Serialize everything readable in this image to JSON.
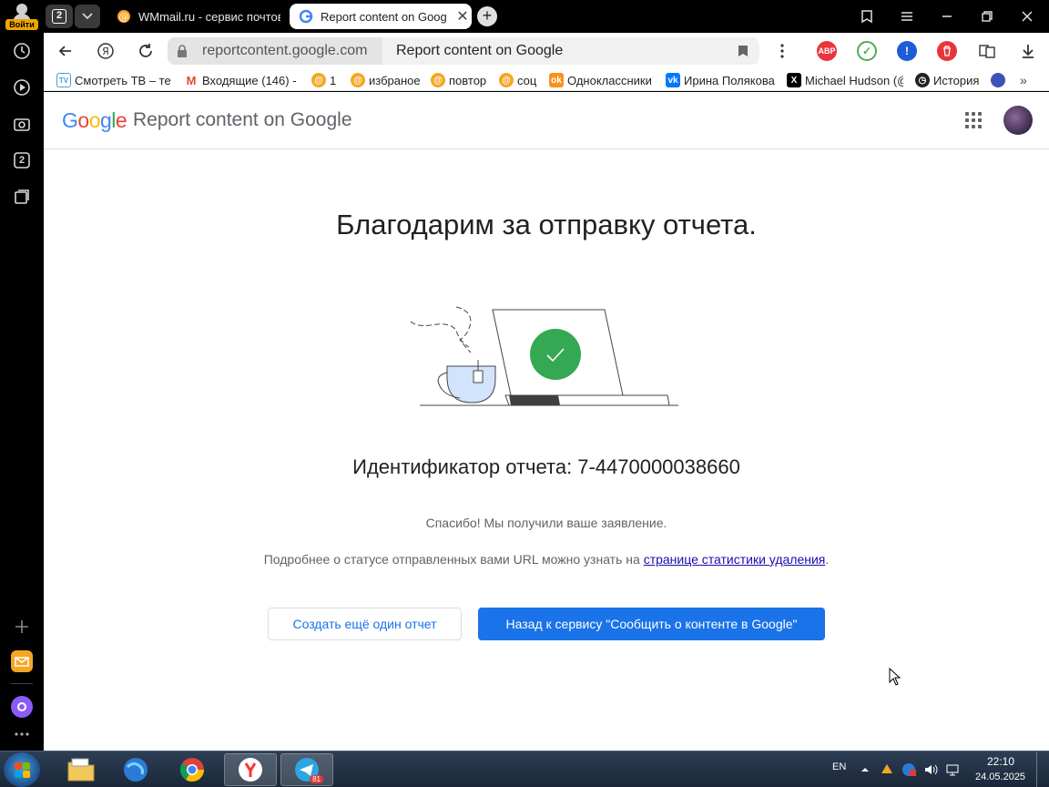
{
  "sidebar": {
    "login_label": "Войти",
    "icons": [
      "history-icon",
      "play-icon",
      "camera-icon",
      "tabs-count-icon",
      "notes-icon",
      "add-icon",
      "mail-icon",
      "alice-icon",
      "more-icon"
    ],
    "tabs_count": "2"
  },
  "tabs": {
    "count": "2",
    "items": [
      {
        "title": "WMmail.ru - сервис почтовых",
        "active": false
      },
      {
        "title": "Report content on Goog",
        "active": true
      }
    ]
  },
  "address_bar": {
    "host": "reportcontent.google.com",
    "page_title": "Report content on Google"
  },
  "extensions": [
    {
      "name": "adblock-plus",
      "label": "ABP",
      "color": "#e8353b"
    },
    {
      "name": "adguard",
      "label": "✓",
      "color": "#4caf50"
    },
    {
      "name": "security-ext",
      "label": "!",
      "color": "#1e5cd8"
    },
    {
      "name": "trash-ext",
      "label": "",
      "color": "#e8353b"
    },
    {
      "name": "translate-ext",
      "label": "",
      "color": "#333333"
    }
  ],
  "bookmarks": [
    {
      "label": "Смотреть ТВ – те",
      "icon": "tv-icon"
    },
    {
      "label": "Входящие (146) -",
      "icon": "gmail-icon"
    },
    {
      "label": "1",
      "icon": "wmmail-icon"
    },
    {
      "label": "избраное",
      "icon": "wmmail-icon"
    },
    {
      "label": "повтор",
      "icon": "wmmail-icon"
    },
    {
      "label": "соц",
      "icon": "wmmail-icon"
    },
    {
      "label": "Одноклассники",
      "icon": "ok-icon"
    },
    {
      "label": "Ирина Полякова",
      "icon": "vk-icon"
    },
    {
      "label": "Michael Hudson (@",
      "icon": "x-icon"
    },
    {
      "label": "История",
      "icon": "history-icon"
    }
  ],
  "header": {
    "logo": "Google",
    "product": "Report content on Google"
  },
  "main": {
    "title": "Благодарим за отправку отчета.",
    "report_id_label": "Идентификатор отчета:",
    "report_id_value": "7-4470000038660",
    "thanks_text": "Спасибо! Мы получили ваше заявление.",
    "more_info_prefix": "Подробнее о статусе отправленных вами URL можно узнать на ",
    "more_info_link": "странице статистики удаления",
    "more_info_suffix": ".",
    "btn_new_report": "Создать ещё один отчет",
    "btn_back": "Назад к сервису \"Сообщить о контенте в Google\""
  },
  "taskbar": {
    "language": "EN",
    "time": "22:10",
    "date": "24.05.2025",
    "telegram_badge": "81"
  },
  "colors": {
    "google_blue": "#4285f4",
    "google_red": "#ea4335",
    "google_yellow": "#fbbc05",
    "google_green": "#34a853",
    "primary_button": "#1a73e8",
    "check_circle": "#34a853"
  }
}
